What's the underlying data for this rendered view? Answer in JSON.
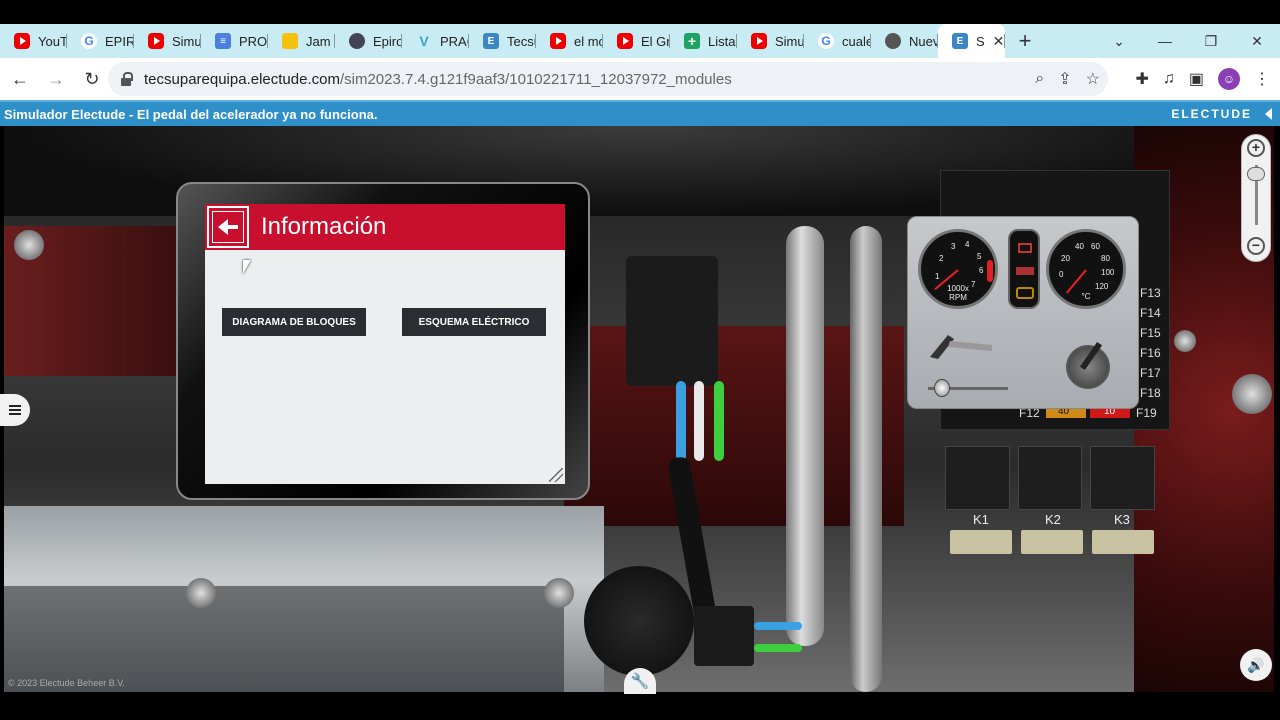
{
  "browser": {
    "tabs": [
      {
        "label": "YouT",
        "icon": "youtube-icon"
      },
      {
        "label": "EPIRO",
        "icon": "google-icon"
      },
      {
        "label": "Simu",
        "icon": "youtube-icon"
      },
      {
        "label": "PROY",
        "icon": "docs-icon"
      },
      {
        "label": "Jam s",
        "icon": "jamboard-icon"
      },
      {
        "label": "Epiro",
        "icon": "epiroc-icon"
      },
      {
        "label": "PRAC",
        "icon": "practice-icon"
      },
      {
        "label": "Tecsu",
        "icon": "electude-icon"
      },
      {
        "label": "el mo",
        "icon": "youtube-icon"
      },
      {
        "label": "El Gr",
        "icon": "youtube-icon"
      },
      {
        "label": "Lista",
        "icon": "sheets-icon"
      },
      {
        "label": "Simu",
        "icon": "youtube-icon"
      },
      {
        "label": "cuale",
        "icon": "google-icon"
      },
      {
        "label": "Nuev",
        "icon": "globe-icon"
      },
      {
        "label": "S",
        "icon": "electude-icon",
        "active": true
      }
    ],
    "new_tab": "+",
    "url_host": "tecsuparequipa.electude.com",
    "url_path": "/sim2023.7.4.g121f9aaf3/1010221711_12037972_modules"
  },
  "app": {
    "title": "Simulador Electude - El pedal del acelerador ya no funciona.",
    "brand": "ELECTUDE",
    "copyright": "© 2023 Electude Beheer B.V."
  },
  "info_panel": {
    "heading": "Información",
    "buttons": {
      "block_diagram": "DIAGRAMA DE BLOQUES",
      "wiring_diagram": "ESQUEMA ELÉCTRICO"
    }
  },
  "dashboard": {
    "rpm_gauge": {
      "ticks": [
        "1",
        "2",
        "3",
        "4",
        "5",
        "6",
        "7"
      ],
      "unit_line1": "1000x",
      "unit_line2": "RPM"
    },
    "temp_gauge": {
      "ticks": [
        "0",
        "20",
        "40",
        "60",
        "80",
        "100",
        "120"
      ],
      "unit": "°C"
    }
  },
  "fusebox": {
    "fuses_right": [
      "F13",
      "F14",
      "F15",
      "F16",
      "F17",
      "F18",
      "F19"
    ],
    "fuse_f12": "F12",
    "fuse_values": [
      "40",
      "10"
    ],
    "relays": [
      "K1",
      "K2",
      "K3"
    ]
  },
  "colors": {
    "app_bar": "#2f8fc9",
    "info_header": "#c8102e",
    "tab_strip": "#c9ecf4"
  }
}
